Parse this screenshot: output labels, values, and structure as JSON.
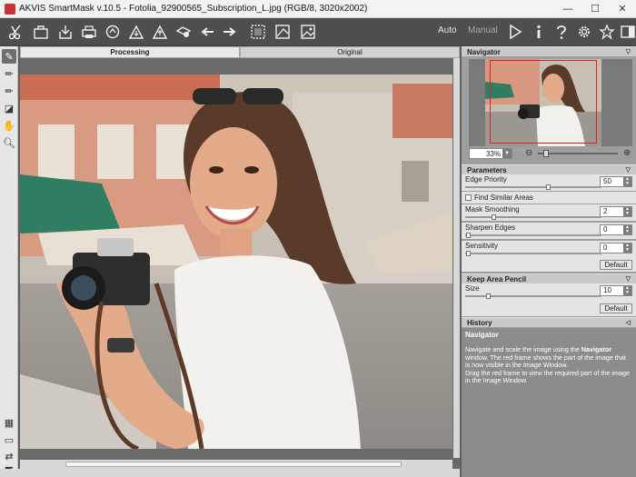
{
  "window": {
    "title": "AKVIS SmartMask v.10.5 - Fotolia_92900565_Subscription_L.jpg (RGB/8, 3020x2002)",
    "minimize": "—",
    "maximize": "☐",
    "close": "✕"
  },
  "toolbar": {
    "mode_auto": "Auto",
    "mode_manual": "Manual"
  },
  "tabs": {
    "processing": "Processing",
    "original": "Original"
  },
  "navigator": {
    "header": "Navigator",
    "zoom": "33%"
  },
  "parameters": {
    "header": "Parameters",
    "edge_priority": {
      "label": "Edge Priority",
      "value": "50",
      "slider_fraction": 0.6
    },
    "find_similar_areas": {
      "label": "Find Similar Areas",
      "checked": false
    },
    "mask_smoothing": {
      "label": "Mask Smoothing",
      "value": "2",
      "slider_fraction": 0.2
    },
    "sharpen_edges": {
      "label": "Sharpen Edges",
      "value": "0",
      "slider_fraction": 0.0
    },
    "sensitivity": {
      "label": "Sensitivity",
      "value": "0",
      "slider_fraction": 0.0
    },
    "default_label": "Default"
  },
  "keep_area_pencil": {
    "header": "Keep Area Pencil",
    "size": {
      "label": "Size",
      "value": "10",
      "slider_fraction": 0.15
    },
    "default_label": "Default"
  },
  "history": {
    "header": "History"
  },
  "help": {
    "title": "Navigator",
    "p1_before": "Navigate and scale the image using the ",
    "p1_bold": "Navigator",
    "p1_after": " window. The red frame shows the part of the image that is now visible in the Image Window.",
    "p2": "Drag the red frame to view the required part of the image in the Image Window."
  }
}
